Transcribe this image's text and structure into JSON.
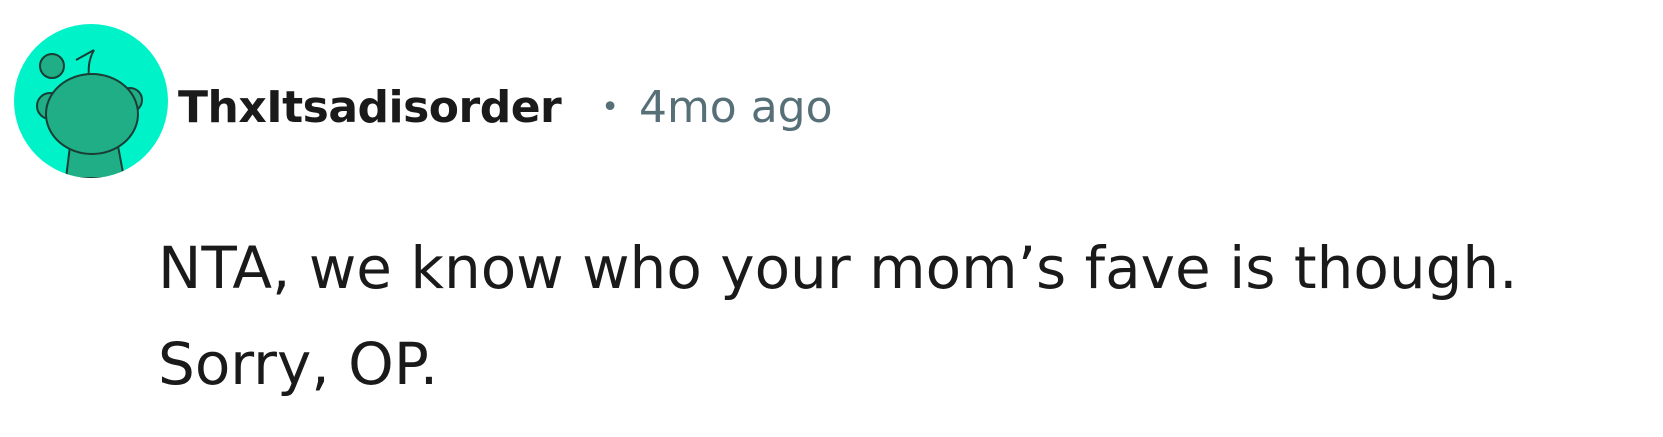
{
  "comment": {
    "author": {
      "username": "ThxItsadisorder",
      "avatar_icon": "snoo-avatar-icon",
      "avatar_color": "#00F2C8",
      "avatar_figure_color": "#1FAE86"
    },
    "separator": "•",
    "timestamp": "4mo ago",
    "body_lines": [
      "NTA, we know who your mom’s fave is though.",
      "Sorry, OP."
    ]
  },
  "colors": {
    "username": "#1A1A1B",
    "meta": "#576F76",
    "body_text": "#1A1A1B",
    "background": "#FFFFFF"
  }
}
